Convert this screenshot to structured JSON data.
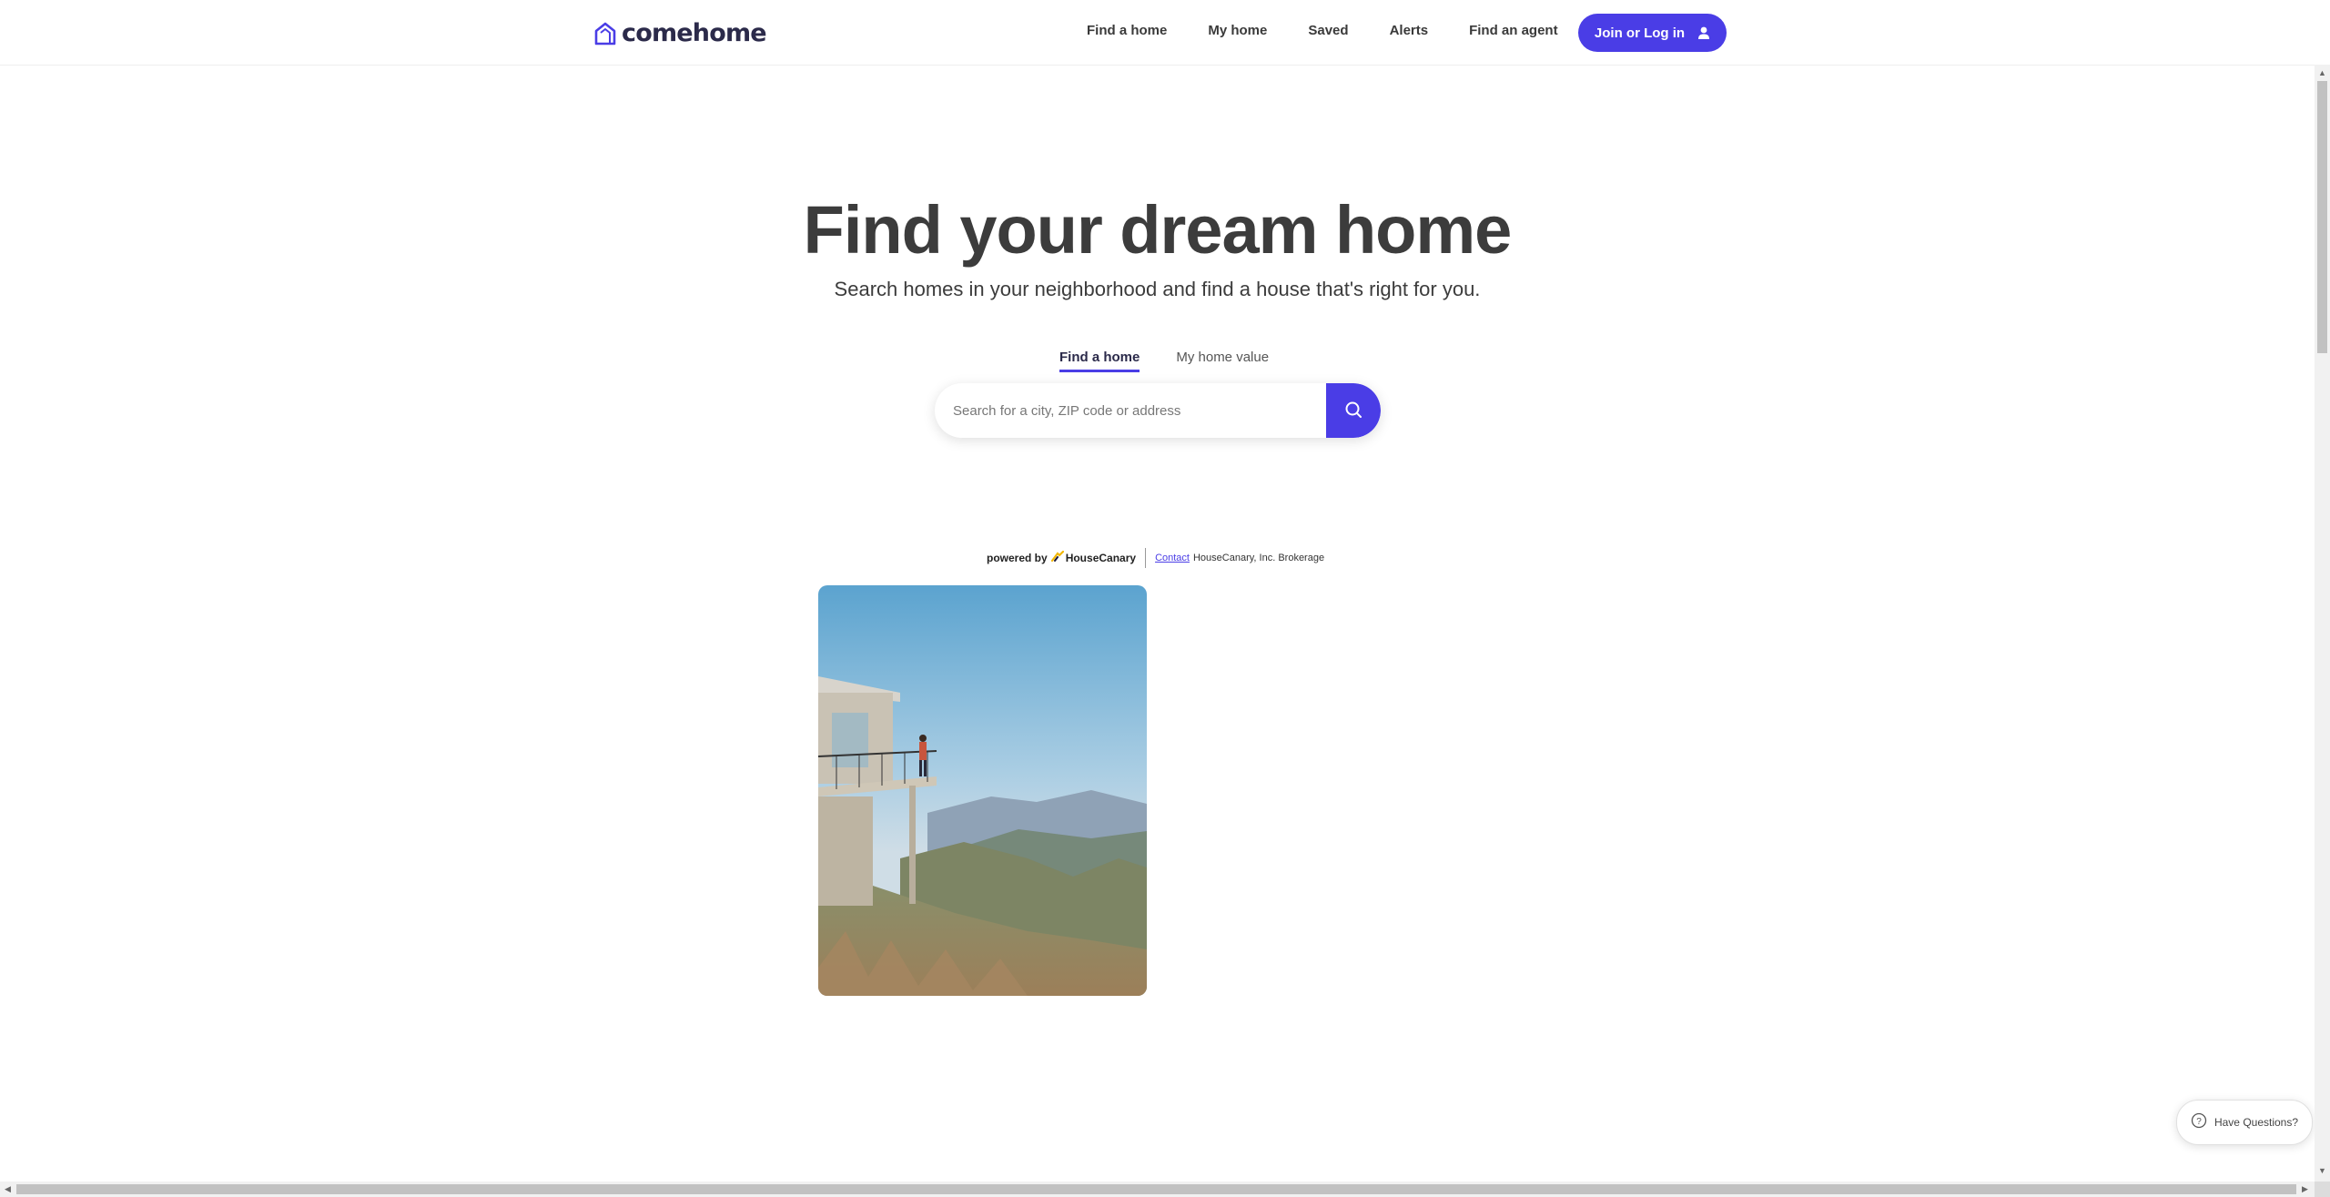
{
  "header": {
    "logo_text": "comehome",
    "nav": [
      {
        "label": "Find a home"
      },
      {
        "label": "My home"
      },
      {
        "label": "Saved"
      },
      {
        "label": "Alerts"
      },
      {
        "label": "Find an agent"
      }
    ],
    "join_label": "Join or Log in"
  },
  "hero": {
    "title": "Find your dream home",
    "subtitle": "Search homes in your neighborhood and find a house that's right for you."
  },
  "tabs": [
    {
      "label": "Find a home",
      "active": true
    },
    {
      "label": "My home value",
      "active": false
    }
  ],
  "search": {
    "placeholder": "Search for a city, ZIP code or address",
    "value": ""
  },
  "powered": {
    "powered_by": "powered by",
    "brand": "HouseCanary",
    "contact_label": "Contact",
    "brokerage": "HouseCanary, Inc. Brokerage"
  },
  "chat": {
    "label": "Have Questions?"
  },
  "colors": {
    "accent": "#4a3de6",
    "text": "#3c3c3c"
  },
  "icons": [
    "house-logo-icon",
    "user-icon",
    "search-icon",
    "housecanary-logo-icon",
    "chat-bubble-icon"
  ]
}
